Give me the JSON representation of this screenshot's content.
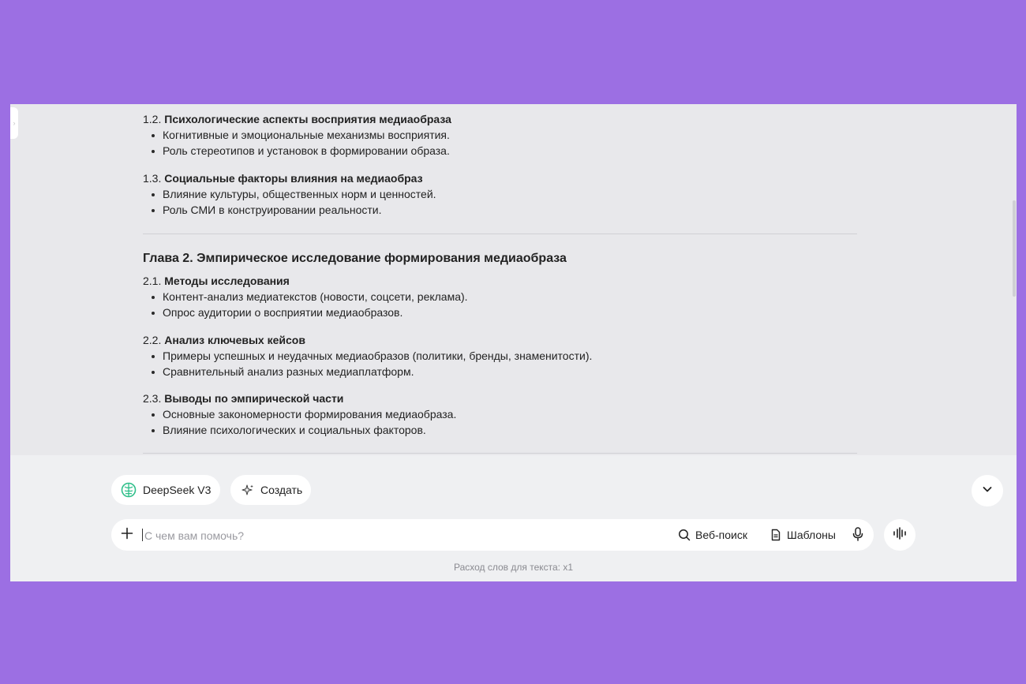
{
  "document": {
    "section_1_2": {
      "num": "1.2.",
      "title": "Психологические аспекты восприятия медиаобраза",
      "bullets": [
        "Когнитивные и эмоциональные механизмы восприятия.",
        "Роль стереотипов и установок в формировании образа."
      ]
    },
    "section_1_3": {
      "num": "1.3.",
      "title": "Социальные факторы влияния на медиаобраз",
      "bullets": [
        "Влияние культуры, общественных норм и ценностей.",
        "Роль СМИ в конструировании реальности."
      ]
    },
    "chapter_2": "Глава 2. Эмпирическое исследование формирования медиаобраза",
    "section_2_1": {
      "num": "2.1.",
      "title": "Методы исследования",
      "bullets": [
        "Контент-анализ медиатекстов (новости, соцсети, реклама).",
        "Опрос аудитории о восприятии медиаобразов."
      ]
    },
    "section_2_2": {
      "num": "2.2.",
      "title": "Анализ ключевых кейсов",
      "bullets": [
        "Примеры успешных и неудачных медиаобразов (политики, бренды, знаменитости).",
        "Сравнительный анализ разных медиаплатформ."
      ]
    },
    "section_2_3": {
      "num": "2.3.",
      "title": "Выводы по эмпирической части",
      "bullets": [
        "Основные закономерности формирования медиаобраза.",
        "Влияние психологических и социальных факторов."
      ]
    }
  },
  "toolbar": {
    "model_label": "DeepSeek V3",
    "model_icon": "brain-icon",
    "create_label": "Создать",
    "create_icon": "sparkle-icon"
  },
  "input": {
    "placeholder": "С чем вам помочь?",
    "value": "",
    "web_search_label": "Веб-поиск",
    "templates_label": "Шаблоны"
  },
  "footer": {
    "usage_note": "Расход слов для текста: x1"
  },
  "colors": {
    "background": "#9c6fe3",
    "window": "#e8e8eb",
    "accent_green": "#2fbf8a"
  }
}
